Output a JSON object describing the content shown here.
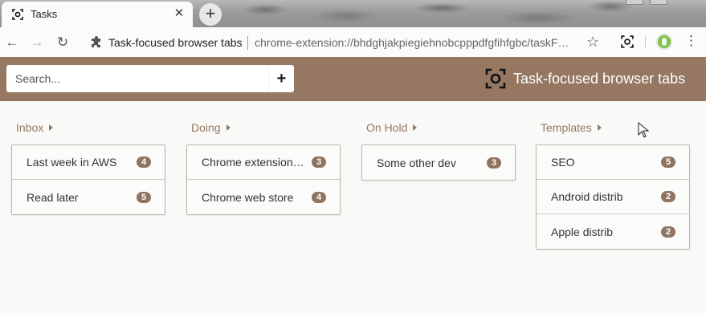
{
  "browser": {
    "tab_title": "Tasks",
    "tab_close": "✕",
    "new_tab": "+",
    "site_name": "Task-focused browser tabs",
    "url": "chrome-extension://bhdghjakpiegiehnobcpppdfgfihfgbc/taskF…"
  },
  "header": {
    "search_placeholder": "Search...",
    "add_label": "+",
    "brand_name": "Task-focused browser tabs",
    "accent_color": "#967762"
  },
  "columns": [
    {
      "title": "Inbox",
      "items": [
        {
          "label": "Last week in AWS",
          "count": "4"
        },
        {
          "label": "Read later",
          "count": "5"
        }
      ]
    },
    {
      "title": "Doing",
      "items": [
        {
          "label": "Chrome extension ...",
          "count": "3"
        },
        {
          "label": "Chrome web store",
          "count": "4"
        }
      ]
    },
    {
      "title": "On Hold",
      "items": [
        {
          "label": "Some other dev",
          "count": "3"
        }
      ]
    },
    {
      "title": "Templates",
      "items": [
        {
          "label": "SEO",
          "count": "5"
        },
        {
          "label": "Android distrib",
          "count": "2"
        },
        {
          "label": "Apple distrib",
          "count": "2"
        }
      ]
    }
  ]
}
